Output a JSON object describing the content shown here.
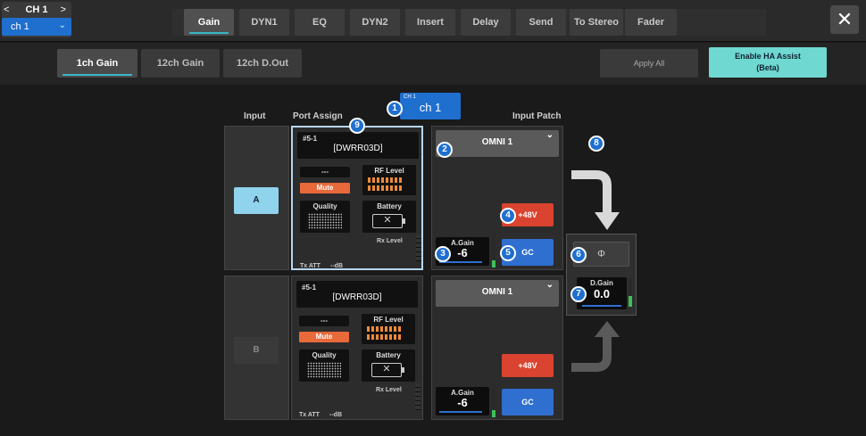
{
  "channel": {
    "top": "CH 1",
    "name": "ch 1"
  },
  "tabs": [
    "Gain",
    "DYN1",
    "EQ",
    "DYN2",
    "Insert",
    "Delay",
    "Send",
    "To Stereo",
    "Fader"
  ],
  "active_tab": "Gain",
  "close_label": "✕",
  "subtabs": [
    "1ch Gain",
    "12ch Gain",
    "12ch D.Out"
  ],
  "active_subtab": "1ch Gain",
  "apply_all": "Apply All",
  "ha_assist": [
    "Enable HA Assist",
    "(Beta)"
  ],
  "headers": {
    "input": "Input",
    "port_assign": "Port Assign",
    "input_patch": "Input Patch"
  },
  "ch_badge": {
    "small": "CH 1",
    "big": "ch 1"
  },
  "callouts": [
    "1",
    "2",
    "3",
    "4",
    "5",
    "6",
    "7",
    "8",
    "9"
  ],
  "inputs": [
    {
      "label": "A",
      "port": {
        "id": "#5-1",
        "name": "[DWRR03D]",
        "dash": "---",
        "mute": "Mute",
        "rf": "RF Level",
        "quality": "Quality",
        "battery": "Battery",
        "rx": "Rx Level",
        "txatt": "Tx ATT",
        "txval": "--dB"
      },
      "patch": "OMNI 1",
      "phantom": "+48V",
      "gain_label": "A.Gain",
      "gain_value": "-6",
      "gc": "GC"
    },
    {
      "label": "B",
      "port": {
        "id": "#5-1",
        "name": "[DWRR03D]",
        "dash": "---",
        "mute": "Mute",
        "rf": "RF Level",
        "quality": "Quality",
        "battery": "Battery",
        "rx": "Rx Level",
        "txatt": "Tx ATT",
        "txval": "--dB"
      },
      "patch": "OMNI 1",
      "phantom": "+48V",
      "gain_label": "A.Gain",
      "gain_value": "-6",
      "gc": "GC"
    }
  ],
  "phase_symbol": "Φ",
  "dgain": {
    "label": "D.Gain",
    "value": "0.0"
  },
  "colors": {
    "accent": "#1f6fcf",
    "teal": "#6fd8d0",
    "phantom": "#d9432f",
    "mute": "#e8693a"
  }
}
